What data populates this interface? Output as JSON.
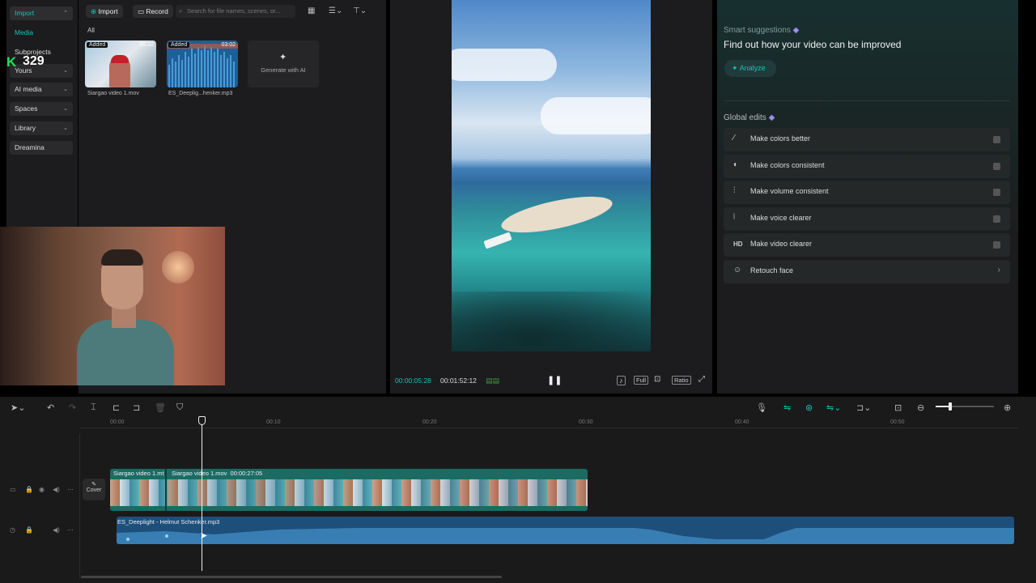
{
  "streak_badge": {
    "count": "329"
  },
  "left_nav": {
    "items": [
      {
        "label": "Import",
        "active": true
      },
      {
        "label": "Media"
      },
      {
        "label": "Subprojects"
      },
      {
        "label": "Yours"
      },
      {
        "label": "AI media"
      },
      {
        "label": "Spaces"
      },
      {
        "label": "Library"
      },
      {
        "label": "Dreamina"
      }
    ]
  },
  "media": {
    "import_label": "Import",
    "record_label": "Record",
    "search_placeholder": "Search for file names, scenes, or...",
    "filter_all": "All",
    "items": [
      {
        "name": "Siargao video 1.mov",
        "tag": "Added",
        "duration": "00:32"
      },
      {
        "name": "ES_Deeplig...henker.mp3",
        "tag": "Added",
        "duration": "03:02"
      }
    ],
    "generate_label": "Generate with AI"
  },
  "preview": {
    "current_time": "00:00:05:28",
    "total_time": "00:01:52:12",
    "full_label": "Full",
    "ratio_label": "Ratio"
  },
  "right_panel": {
    "smart_title": "Smart suggestions",
    "smart_subtitle": "Find out how your video can be improved",
    "analyze_label": "Analyze",
    "global_title": "Global edits",
    "edits": [
      {
        "label": "Make colors better",
        "icon": "wand-icon"
      },
      {
        "label": "Make colors consistent",
        "icon": "palette-icon"
      },
      {
        "label": "Make volume consistent",
        "icon": "sliders-icon"
      },
      {
        "label": "Make voice clearer",
        "icon": "voice-icon"
      },
      {
        "label": "Make video clearer",
        "icon": "hd-icon"
      },
      {
        "label": "Retouch face",
        "icon": "face-icon"
      }
    ],
    "hd_text": "HD"
  },
  "timeline": {
    "ruler": [
      "00:00",
      "00:10",
      "00:20",
      "00:30",
      "00:40",
      "00:50"
    ],
    "cover_label": "Cover",
    "video_clip1": "Siargao video 1.mt",
    "video_clip2": "Siargao video 1.mov",
    "video_clip2_dur": "00:00:27:05",
    "audio_clip": "ES_Deeplight - Helmut Schenker.mp3"
  },
  "colors": {
    "accent": "#19c3b5",
    "audio": "#1e4f7a",
    "video": "#1b6b63"
  }
}
